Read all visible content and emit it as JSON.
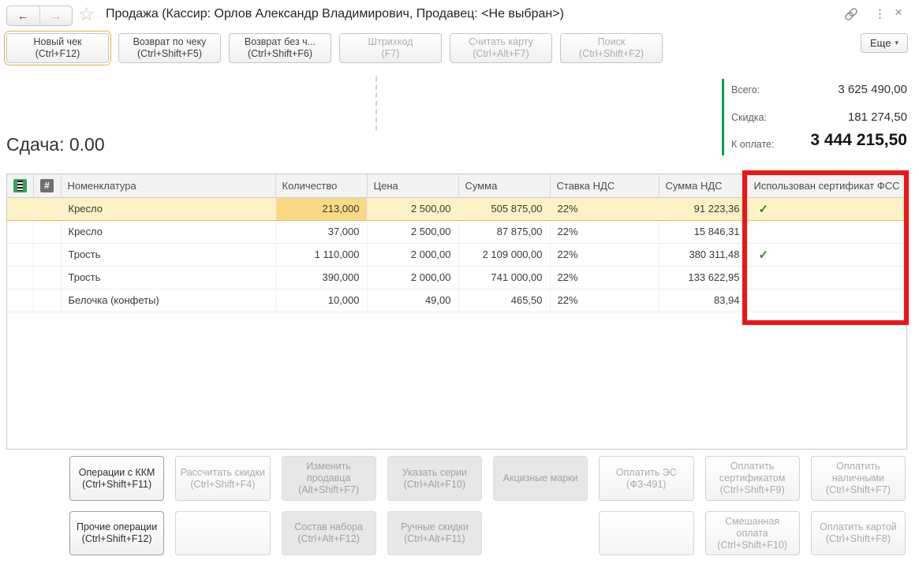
{
  "window": {
    "title": "Продажа (Кассир: Орлов Александр Владимирович, Продавец: <Не выбран>)",
    "nav_back_icon": "←",
    "nav_forward_icon": "→",
    "favorite_icon": "☆",
    "menu_icon": "⋮",
    "close_icon": "×"
  },
  "toolbar": {
    "buttons": [
      {
        "label": "Новый чек",
        "shortcut": "(Ctrl+F12)"
      },
      {
        "label": "Возврат по чеку",
        "shortcut": "(Ctrl+Shift+F5)"
      },
      {
        "label": "Возврат без ч...",
        "shortcut": "(Ctrl+Shift+F6)"
      },
      {
        "label": "Штрихкод",
        "shortcut": "(F7)"
      },
      {
        "label": "Считать карту",
        "shortcut": "(Ctrl+Alt+F7)"
      },
      {
        "label": "Поиск",
        "shortcut": "(Ctrl+Shift+F2)"
      }
    ],
    "more_button": {
      "label": "Еще",
      "arrow_icon": "▾"
    }
  },
  "summary": {
    "total_label": "Всего:",
    "total_value": "3 625 490,00",
    "discount_label": "Скидка:",
    "discount_value": "181 274,50",
    "due_label": "К оплате:",
    "due_value": "3 444 215,50"
  },
  "change": {
    "label": "Сдача:",
    "value": "0.00"
  },
  "table": {
    "number_icon": "#",
    "columns": [
      "Номенклатура",
      "Количество",
      "Цена",
      "Сумма",
      "Ставка НДС",
      "Сумма НДС",
      "Использован сертификат ФСС"
    ],
    "rows": [
      {
        "name": "Кресло",
        "qty": "213,000",
        "price": "2 500,00",
        "sum": "505 875,00",
        "vat_rate": "22%",
        "vat_sum": "91 223,36",
        "fss": "✓"
      },
      {
        "name": "Кресло",
        "qty": "37,000",
        "price": "2 500,00",
        "sum": "87 875,00",
        "vat_rate": "22%",
        "vat_sum": "15 846,31",
        "fss": ""
      },
      {
        "name": "Трость",
        "qty": "1 110,000",
        "price": "2 000,00",
        "sum": "2 109 000,00",
        "vat_rate": "22%",
        "vat_sum": "380 311,48",
        "fss": "✓"
      },
      {
        "name": "Трость",
        "qty": "390,000",
        "price": "2 000,00",
        "sum": "741 000,00",
        "vat_rate": "22%",
        "vat_sum": "133 622,95",
        "fss": ""
      },
      {
        "name": "Белочка (конфеты)",
        "qty": "10,000",
        "price": "49,00",
        "sum": "465,50",
        "vat_rate": "22%",
        "vat_sum": "83,94",
        "fss": ""
      }
    ]
  },
  "actions": {
    "row1": [
      {
        "label": "Операции с ККМ",
        "shortcut": "(Ctrl+Shift+F11)"
      },
      {
        "label": "Рассчитать скидки",
        "shortcut": "(Ctrl+Shift+F4)"
      },
      {
        "label": "Изменить продавца",
        "shortcut": "(Alt+Shift+F7)"
      },
      {
        "label": "Указать серии",
        "shortcut": "(Ctrl+Alt+F10)"
      },
      {
        "label": "Акцизные марки",
        "shortcut": ""
      },
      {
        "label": "Оплатить ЭС",
        "shortcut": "(ФЗ-491)"
      },
      {
        "label": "Оплатить сертификатом",
        "shortcut": "(Ctrl+Shift+F9)"
      },
      {
        "label": "Оплатить наличными",
        "shortcut": "(Ctrl+Shift+F7)"
      }
    ],
    "row2": [
      {
        "label": "Прочие операции",
        "shortcut": "(Ctrl+Shift+F12)"
      },
      {
        "label": "",
        "shortcut": ""
      },
      {
        "label": "Состав набора",
        "shortcut": "(Ctrl+Alt+F12)"
      },
      {
        "label": "Ручные скидки",
        "shortcut": "(Ctrl+Alt+F11)"
      },
      {
        "label": "",
        "shortcut": ""
      },
      {
        "label": "",
        "shortcut": ""
      },
      {
        "label": "Смешанная оплата",
        "shortcut": "(Ctrl+Shift+F10)"
      },
      {
        "label": "Оплатить картой",
        "shortcut": "(Ctrl+Shift+F8)"
      }
    ]
  },
  "colors": {
    "accent_green": "#00A04B",
    "highlight_row": "#FDF1C6",
    "highlight_cell": "#F8DA85",
    "attention_red": "#EE1414",
    "check_green": "#2C8A2C",
    "focus_yellow": "#E2B33C"
  }
}
